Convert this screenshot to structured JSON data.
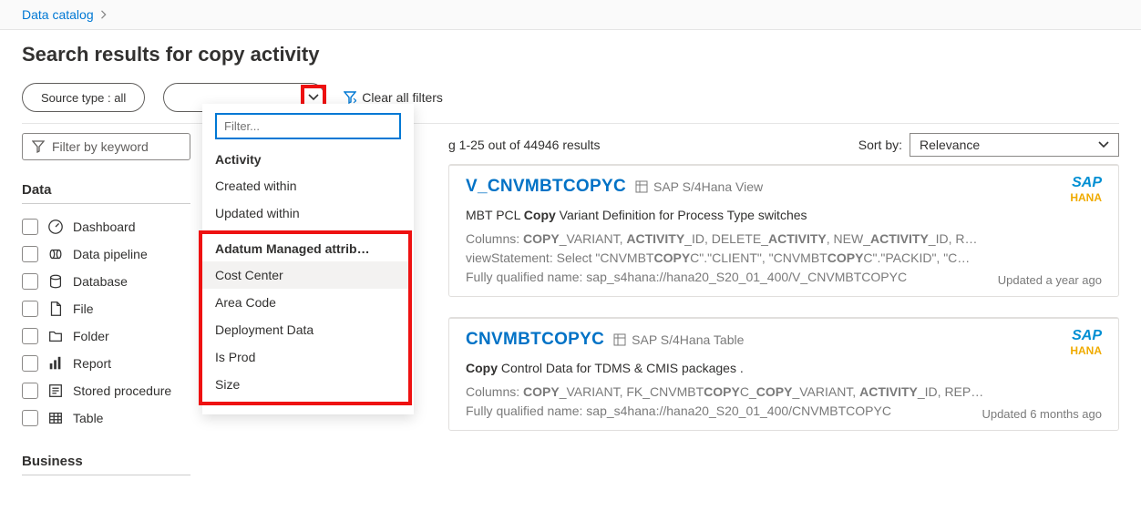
{
  "breadcrumb": {
    "root": "Data catalog"
  },
  "page_title": "Search results for copy activity",
  "filters": {
    "source_pill": "Source type : all",
    "clear": "Clear all filters",
    "filter_keyword_placeholder": "Filter by keyword"
  },
  "dropdown": {
    "filter_placeholder": "Filter...",
    "group1_head": "Activity",
    "group1_items": [
      "Created within",
      "Updated within"
    ],
    "group2_head": "Adatum Managed attrib…",
    "group2_items": [
      "Cost Center",
      "Area Code",
      "Deployment Data",
      "Is Prod",
      "Size"
    ]
  },
  "facets_head_data": "Data",
  "facets_data": [
    {
      "icon": "dashboard",
      "label": "Dashboard"
    },
    {
      "icon": "pipeline",
      "label": "Data pipeline"
    },
    {
      "icon": "database",
      "label": "Database"
    },
    {
      "icon": "file",
      "label": "File"
    },
    {
      "icon": "folder",
      "label": "Folder"
    },
    {
      "icon": "report",
      "label": "Report"
    },
    {
      "icon": "sproc",
      "label": "Stored procedure"
    },
    {
      "icon": "table",
      "label": "Table"
    }
  ],
  "facets_head_business": "Business",
  "results_count": "g 1-25 out of 44946 results",
  "sort_label": "Sort by:",
  "sort_value": "Relevance",
  "results": [
    {
      "title": "V_CNVMBTCOPYC",
      "subtype": "SAP S/4Hana View",
      "desc_html": "MBT PCL <b>Copy</b> Variant Definition for Process Type switches",
      "line1_html": "Columns: <b>COPY</b>_VARIANT, <b>ACTIVITY</b>_ID, DELETE_<b>ACTIVITY</b>, NEW_<b>ACTIVITY</b>_ID, R…",
      "line2_html": "viewStatement: Select \"CNVMBT<b>COPY</b>C\".\"CLIENT\", \"CNVMBT<b>COPY</b>C\".\"PACKID\", \"C…",
      "line3_html": "Fully qualified name: sap_s4hana://hana20_S20_01_400/V_CNVMBTCOPYC",
      "updated": "Updated a year ago",
      "brand": "SAP",
      "brand2": "HANA"
    },
    {
      "title": "CNVMBTCOPYC",
      "subtype": "SAP S/4Hana Table",
      "desc_html": "<b>Copy</b> Control Data for TDMS & CMIS packages .",
      "line1_html": "Columns: <b>COPY</b>_VARIANT, FK_CNVMBT<b>COPY</b>C_<b>COPY</b>_VARIANT, <b>ACTIVITY</b>_ID, REP…",
      "line2_html": "Fully qualified name: sap_s4hana://hana20_S20_01_400/CNVMBTCOPYC",
      "line3_html": "",
      "updated": "Updated 6 months ago",
      "brand": "SAP",
      "brand2": "HANA"
    }
  ]
}
